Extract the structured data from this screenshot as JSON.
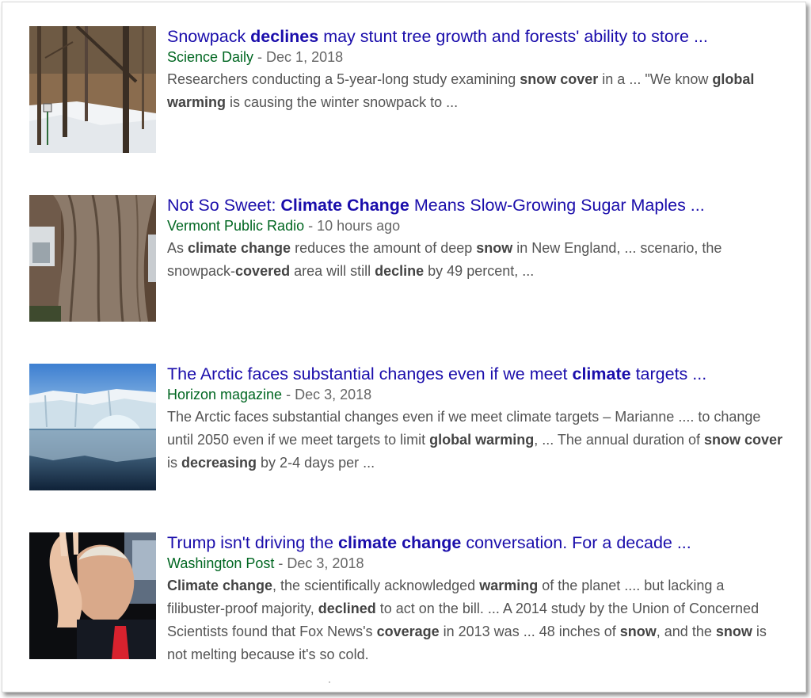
{
  "results": [
    {
      "title": [
        {
          "t": "Snowpack ",
          "b": false
        },
        {
          "t": "declines",
          "b": true
        },
        {
          "t": " may stunt tree growth and forests' ability to store ...",
          "b": false
        }
      ],
      "source": "Science Daily",
      "separator": " - ",
      "date": "Dec 1, 2018",
      "snippet": [
        {
          "t": "Researchers conducting a 5-year-long study examining ",
          "b": false
        },
        {
          "t": "snow cover",
          "b": true
        },
        {
          "t": " in a ... \"We know ",
          "b": false
        },
        {
          "t": "global warming",
          "b": true
        },
        {
          "t": " is causing the winter snowpack to ...",
          "b": false
        }
      ],
      "thumbnail_icon": "snowy-forest-image"
    },
    {
      "title": [
        {
          "t": "Not So Sweet: ",
          "b": false
        },
        {
          "t": "Climate Change",
          "b": true
        },
        {
          "t": " Means Slow-Growing Sugar Maples ...",
          "b": false
        }
      ],
      "source": "Vermont Public Radio",
      "separator": " - ",
      "date": "10 hours ago",
      "snippet": [
        {
          "t": "As ",
          "b": false
        },
        {
          "t": "climate change",
          "b": true
        },
        {
          "t": " reduces the amount of deep ",
          "b": false
        },
        {
          "t": "snow",
          "b": true
        },
        {
          "t": " in New England, ... scenario, the snowpack-",
          "b": false
        },
        {
          "t": "covered",
          "b": true
        },
        {
          "t": " area will still ",
          "b": false
        },
        {
          "t": "decline",
          "b": true
        },
        {
          "t": " by 49 percent, ...",
          "b": false
        }
      ],
      "thumbnail_icon": "maple-tree-trunk-image"
    },
    {
      "title": [
        {
          "t": "The Arctic faces substantial changes even if we meet ",
          "b": false
        },
        {
          "t": "climate",
          "b": true
        },
        {
          "t": " targets ...",
          "b": false
        }
      ],
      "source": "Horizon magazine",
      "separator": " - ",
      "date": "Dec 3, 2018",
      "snippet": [
        {
          "t": "The Arctic faces substantial changes even if we meet climate targets – Marianne .... to change until 2050 even if we meet targets to limit ",
          "b": false
        },
        {
          "t": "global warming",
          "b": true
        },
        {
          "t": ", ... The annual duration of ",
          "b": false
        },
        {
          "t": "snow cover",
          "b": true
        },
        {
          "t": " is ",
          "b": false
        },
        {
          "t": "decreasing",
          "b": true
        },
        {
          "t": " by 2-4 days per ...",
          "b": false
        }
      ],
      "thumbnail_icon": "arctic-glacier-image"
    },
    {
      "title": [
        {
          "t": "Trump isn't driving the ",
          "b": false
        },
        {
          "t": "climate change",
          "b": true
        },
        {
          "t": " conversation. For a decade ...",
          "b": false
        }
      ],
      "source": "Washington Post",
      "separator": " - ",
      "date": "Dec 3, 2018",
      "snippet": [
        {
          "t": "Climate change",
          "b": true
        },
        {
          "t": ", the scientifically acknowledged ",
          "b": false
        },
        {
          "t": "warming",
          "b": true
        },
        {
          "t": " of the planet .... but lacking a filibuster-proof majority, ",
          "b": false
        },
        {
          "t": "declined",
          "b": true
        },
        {
          "t": " to act on the bill. ... A 2014 study by the Union of Concerned Scientists found that Fox News's ",
          "b": false
        },
        {
          "t": "coverage",
          "b": true
        },
        {
          "t": " in 2013 was ... 48 inches of ",
          "b": false
        },
        {
          "t": "snow",
          "b": true
        },
        {
          "t": ", and the ",
          "b": false
        },
        {
          "t": "snow",
          "b": true
        },
        {
          "t": " is not melting because it's so cold.",
          "b": false
        }
      ],
      "thumbnail_icon": "person-waving-image"
    }
  ],
  "colors": {
    "title_link": "#1a0dab",
    "source": "#006621",
    "meta": "#666666",
    "snippet": "#545454"
  }
}
